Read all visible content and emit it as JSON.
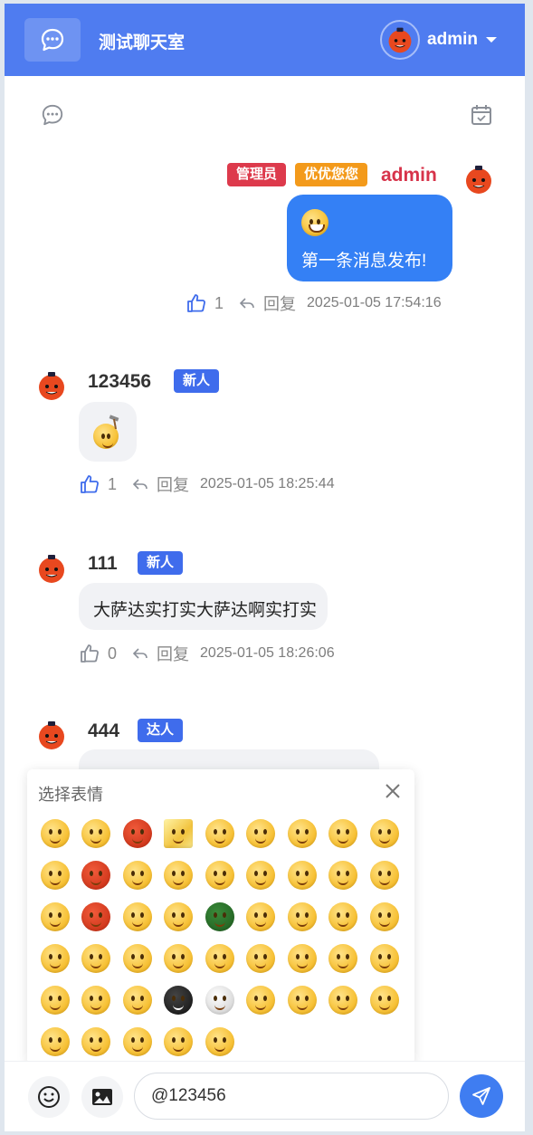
{
  "header": {
    "title": "测试聊天室",
    "username": "admin"
  },
  "messages": [
    {
      "badges": [
        "管理员",
        "优优您您"
      ],
      "name": "admin",
      "text": "第一条消息发布!",
      "likes": "1",
      "reply_label": "回复",
      "timestamp": "2025-01-05 17:54:16"
    },
    {
      "name": "123456",
      "badge": "新人",
      "likes": "1",
      "reply_label": "回复",
      "timestamp": "2025-01-05 18:25:44"
    },
    {
      "name": "111",
      "badge": "新人",
      "text": "大萨达实打实大萨达啊实打实",
      "likes": "0",
      "reply_label": "回复",
      "timestamp": "2025-01-05 18:26:06"
    },
    {
      "name": "444",
      "badge": "达人"
    }
  ],
  "emoji_panel": {
    "title": "选择表情",
    "count": 50
  },
  "composer": {
    "input_value": "@123456"
  },
  "colors": {
    "header": "#4f7cf0",
    "accent": "#3480f5",
    "admin_name": "#d7334a",
    "badge_admin": "#dd3a4c",
    "badge_vip": "#f39a1b",
    "badge_new": "#3f6cec"
  }
}
